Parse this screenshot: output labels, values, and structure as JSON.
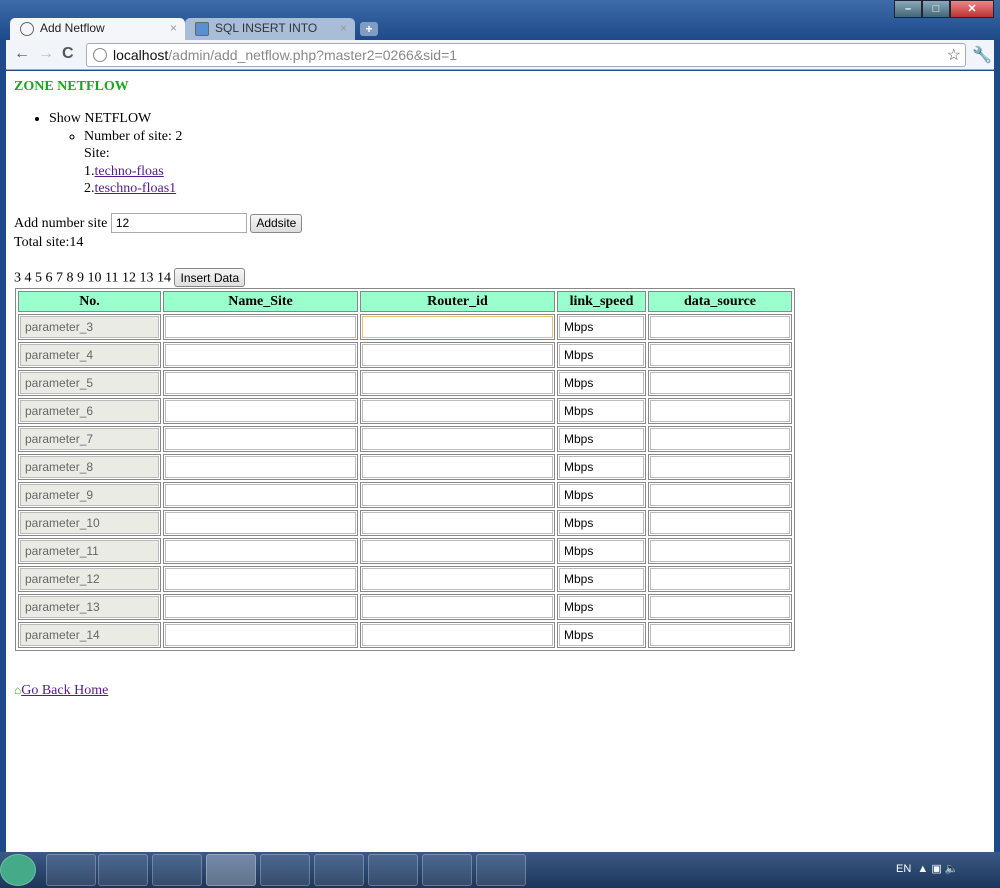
{
  "browser": {
    "tabs": [
      {
        "label": "Add Netflow"
      },
      {
        "label": "SQL INSERT INTO"
      }
    ],
    "url_host": "localhost",
    "url_path": "/admin/add_netflow.php?master2=0266&sid=1"
  },
  "page": {
    "zone_title": "ZONE NETFLOW",
    "show_label": "Show NETFLOW",
    "number_of_site": "Number of site: 2",
    "site_label": "Site:",
    "sites": [
      {
        "num": "1.",
        "name": "techno-floas"
      },
      {
        "num": "2.",
        "name": "teschno-floas1"
      }
    ],
    "add_label": "Add number site",
    "add_value": "12",
    "addsite_button": "Addsite",
    "total": "Total site:14",
    "numbers": "3 4 5 6 7 8 9 10 11 12 13 14",
    "insert_button": "Insert Data",
    "columns": [
      "No.",
      "Name_Site",
      "Router_id",
      "link_speed",
      "data_source"
    ],
    "rows": [
      "parameter_3",
      "parameter_4",
      "parameter_5",
      "parameter_6",
      "parameter_7",
      "parameter_8",
      "parameter_9",
      "parameter_10",
      "parameter_11",
      "parameter_12",
      "parameter_13",
      "parameter_14"
    ],
    "link_speed_value": "Mbps",
    "home_link": "Go Back Home"
  },
  "taskbar": {
    "lang": "EN"
  }
}
